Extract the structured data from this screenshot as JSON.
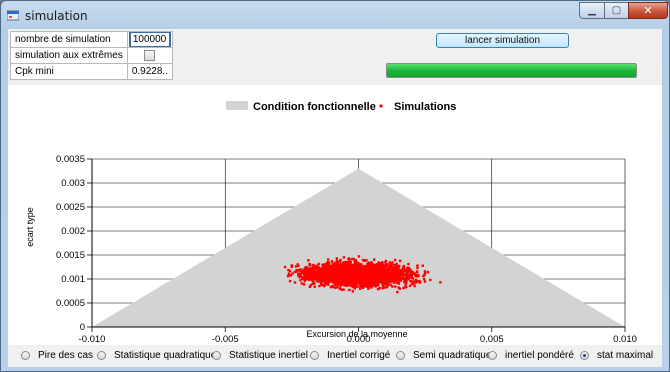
{
  "window": {
    "title": "simulation"
  },
  "params": [
    {
      "label": "nombre de simulation",
      "value": "100000"
    },
    {
      "label": "simulation aux extrêmes",
      "value": ""
    },
    {
      "label": "Cpk mini",
      "value": "0.9228.."
    }
  ],
  "actions": {
    "run_label": "lancer simulation",
    "progress_fraction": 1.0
  },
  "chart_data": {
    "type": "scatter",
    "xlabel": "Excursion de la moyenne",
    "ylabel": "ecart type",
    "xlim": [
      -0.01,
      0.01
    ],
    "ylim": [
      0,
      0.0035
    ],
    "xticks": [
      "-0.010",
      "-0.005",
      "0.000",
      "0.005",
      "0.010"
    ],
    "yticks": [
      "0",
      "0.0005",
      "0.001",
      "0.0015",
      "0.002",
      "0.0025",
      "0.003",
      "0.0035"
    ],
    "grid": true,
    "legend_position": "top-center",
    "series": [
      {
        "name": "Condition fonctionnelle",
        "kind": "area",
        "color": "#d3d3d3",
        "x": [
          -0.01,
          0.0,
          0.01
        ],
        "y": [
          0,
          0.0033,
          0
        ]
      },
      {
        "name": "Simulations",
        "kind": "points",
        "color": "#ff0000",
        "center_x": 0.0,
        "center_y": 0.0011,
        "spread_x": 0.0075,
        "spread_y": 0.0009,
        "y_min": 0.0002,
        "y_max": 0.0021
      }
    ]
  },
  "options": [
    {
      "label": "Pire des cas",
      "checked": false
    },
    {
      "label": "Statistique quadratique",
      "checked": false
    },
    {
      "label": "Statistique inertiel",
      "checked": false
    },
    {
      "label": "Inertiel corrigé",
      "checked": false
    },
    {
      "label": "Semi quadratique",
      "checked": false
    },
    {
      "label": "inertiel pondéré",
      "checked": false
    },
    {
      "label": "stat maximal",
      "checked": true
    }
  ],
  "colors": {
    "accent": "#1eb83c",
    "points": "#ff0000",
    "region": "#d3d3d3"
  }
}
